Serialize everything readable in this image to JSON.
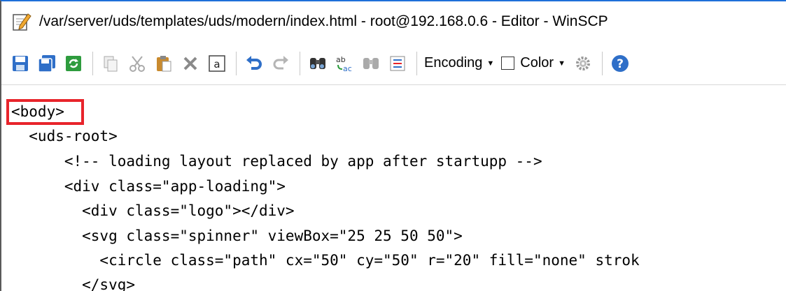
{
  "window": {
    "title": "/var/server/uds/templates/uds/modern/index.html - root@192.168.0.6 - Editor - WinSCP"
  },
  "toolbar": {
    "encoding_label": "Encoding",
    "color_label": "Color",
    "color_checked": false,
    "buttons": [
      "save-icon",
      "save-all-icon",
      "reload-icon",
      "copy-icon",
      "cut-icon",
      "paste-icon",
      "delete-icon",
      "select-all-icon",
      "undo-icon",
      "redo-icon",
      "find-icon",
      "replace-icon",
      "find-next-icon",
      "go-to-line-icon",
      "settings-icon",
      "help-icon"
    ]
  },
  "editor": {
    "lines": [
      "<body>",
      "  <uds-root>",
      "      <!-- loading layout replaced by app after startupp -->",
      "      <div class=\"app-loading\">",
      "        <div class=\"logo\"></div>",
      "        <svg class=\"spinner\" viewBox=\"25 25 50 50\">",
      "          <circle class=\"path\" cx=\"50\" cy=\"50\" r=\"20\" fill=\"none\" strok",
      "        </svg>"
    ]
  },
  "colors": {
    "highlight": "#e8242b",
    "accent": "#1e6fd9"
  }
}
